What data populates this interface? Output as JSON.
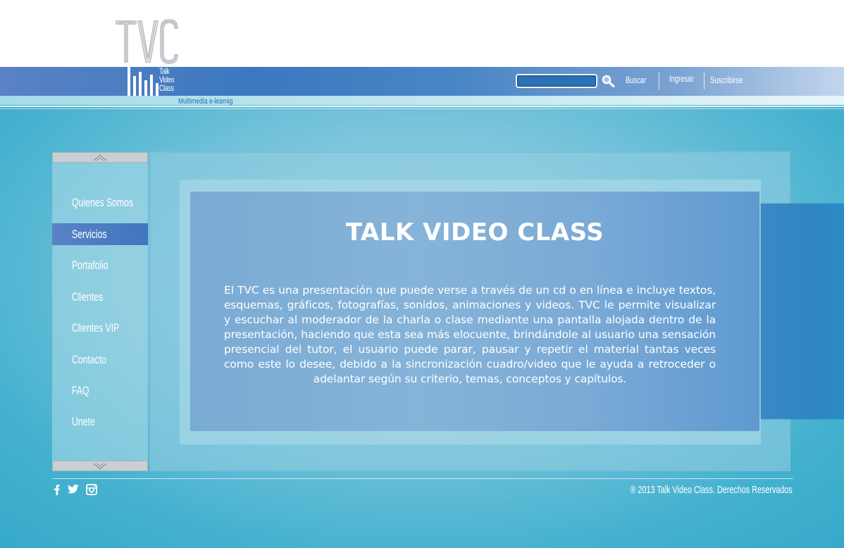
{
  "brand": {
    "logo_letters": "TVC",
    "logo_words": [
      "Talk",
      "Video",
      "Class"
    ],
    "tagline": "Multimedia e-learnig"
  },
  "header": {
    "search": {
      "value": "",
      "placeholder": ""
    },
    "search_button_label": "Buscar",
    "login_label": "Ingresar",
    "subscribe_label": "Suscribirse"
  },
  "sidebar": {
    "items": [
      {
        "label": "Quienes Somos",
        "active": false
      },
      {
        "label": "Servicios",
        "active": true
      },
      {
        "label": "Portafolio",
        "active": false
      },
      {
        "label": "Clientes",
        "active": false
      },
      {
        "label": "Clientes VIP",
        "active": false
      },
      {
        "label": "Contacto",
        "active": false
      },
      {
        "label": "FAQ",
        "active": false
      },
      {
        "label": "Unete",
        "active": false
      }
    ]
  },
  "main": {
    "title": "TALK VIDEO CLASS",
    "body": "El TVC es una presentación que puede verse a través de un cd o en línea e incluye textos, esquemas, gráficos, fotografías, sonidos, animaciones y videos. TVC le permite visualizar y escuchar al moderador de la charla o clase mediante una pantalla alojada dentro de la presentación, haciendo que esta sea más elocuente, brindándole al usuario una sensación presencial del tutor, el usuario puede parar, pausar y repetir el material tantas veces como este lo desee, debido a la sincronización cuadro/video que le ayuda a retroceder o adelantar según su criterio, temas, conceptos y capítulos."
  },
  "footer": {
    "social_icons": [
      "facebook-icon",
      "twitter-icon",
      "instagram-icon"
    ],
    "copyright": "® 2013 Talk Video Class. Derechos Reservados"
  },
  "colors": {
    "header_band": "#3b78c0",
    "active_menu": "#4a7bc3",
    "panel": "#7aabd4",
    "side_tab": "#2f86c3",
    "text_light": "#ffffff"
  }
}
